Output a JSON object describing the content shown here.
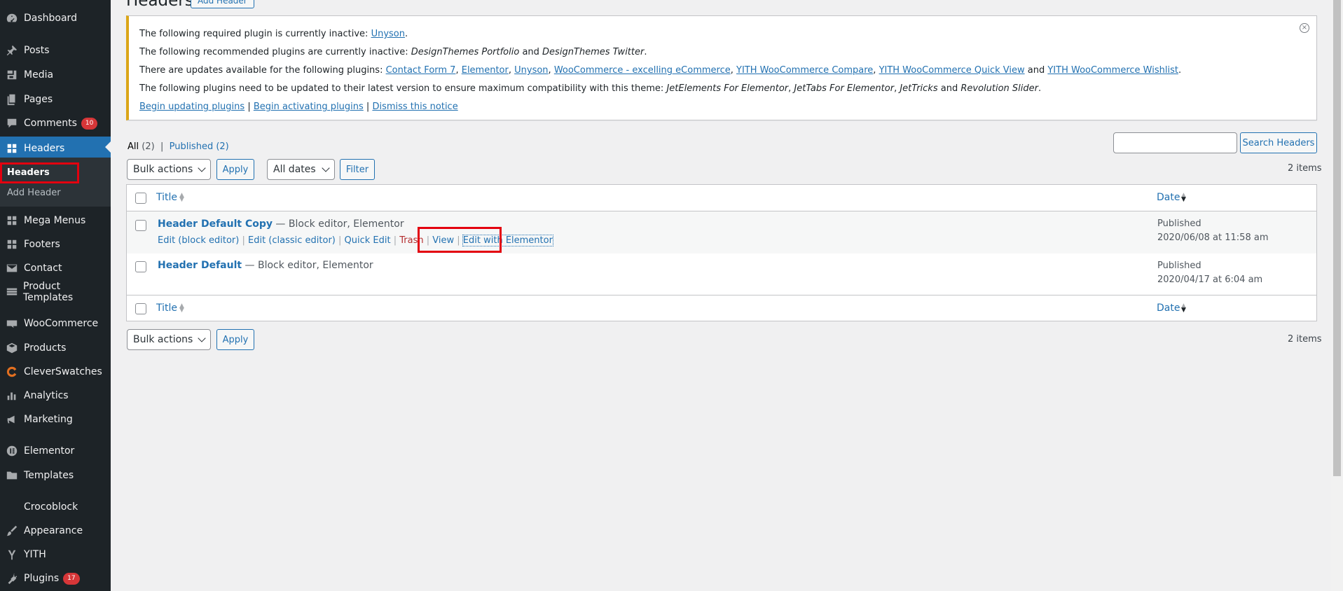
{
  "sidebar": {
    "items": [
      {
        "label": "Dashboard",
        "icon": "dashboard-icon"
      },
      {
        "label": "Posts",
        "icon": "pushpin-icon"
      },
      {
        "label": "Media",
        "icon": "media-icon"
      },
      {
        "label": "Pages",
        "icon": "pages-icon"
      },
      {
        "label": "Comments",
        "icon": "comments-icon",
        "badge": "10"
      },
      {
        "label": "Headers",
        "icon": "grid-icon"
      },
      {
        "label": "Mega Menus",
        "icon": "grid-icon"
      },
      {
        "label": "Footers",
        "icon": "grid-icon"
      },
      {
        "label": "Contact",
        "icon": "mail-icon"
      },
      {
        "label": "Product Templates",
        "icon": "table-icon"
      },
      {
        "label": "WooCommerce",
        "icon": "woo-icon"
      },
      {
        "label": "Products",
        "icon": "box-icon"
      },
      {
        "label": "CleverSwatches",
        "icon": "swatch-icon"
      },
      {
        "label": "Analytics",
        "icon": "bar-chart-icon"
      },
      {
        "label": "Marketing",
        "icon": "megaphone-icon"
      },
      {
        "label": "Elementor",
        "icon": "elementor-icon"
      },
      {
        "label": "Templates",
        "icon": "folder-icon"
      },
      {
        "label": "Crocoblock",
        "icon": ""
      },
      {
        "label": "Appearance",
        "icon": "brush-icon"
      },
      {
        "label": "YITH",
        "icon": "yith-icon"
      },
      {
        "label": "Plugins",
        "icon": "plug-icon",
        "badge": "17"
      }
    ],
    "submenu": {
      "headers": "Headers",
      "add_header": "Add Header"
    }
  },
  "page": {
    "title": "Headers",
    "add_button": "Add Header"
  },
  "notice": {
    "line1_pre": "The following required plugin is currently inactive: ",
    "line1_link": "Unyson",
    "line1_post": ".",
    "line2_pre": "The following recommended plugins are currently inactive: ",
    "line2_i1": "DesignThemes Portfolio",
    "line2_mid": " and ",
    "line2_i2": "DesignThemes Twitter",
    "line2_post": ".",
    "line3_pre": "There are updates available for the following plugins: ",
    "line3_links": [
      "Contact Form 7",
      "Elementor",
      "Unyson",
      "WooCommerce - excelling eCommerce",
      "YITH WooCommerce Compare",
      "YITH WooCommerce Quick View",
      "YITH WooCommerce Wishlist"
    ],
    "line3_and": " and ",
    "line4_pre": "The following plugins need to be updated to their latest version to ensure maximum compatibility with this theme: ",
    "line4_i1": "JetElements For Elementor",
    "line4_i2": "JetTabs For Elementor",
    "line4_i3": "JetTricks",
    "line4_i4": "Revolution Slider",
    "line4_and": " and ",
    "actions": [
      "Begin updating plugins",
      "Begin activating plugins",
      "Dismiss this notice"
    ]
  },
  "views": {
    "all": "All",
    "all_count": "(2)",
    "published": "Published",
    "published_count": "(2)"
  },
  "search": {
    "button": "Search Headers",
    "value": ""
  },
  "filters": {
    "bulk_actions": "Bulk actions",
    "apply": "Apply",
    "dates": "All dates",
    "filter": "Filter",
    "items_count": "2 items"
  },
  "table": {
    "columns": {
      "title": "Title",
      "date": "Date"
    },
    "rows": [
      {
        "title": "Header Default Copy",
        "state": " — Block editor, Elementor",
        "actions": [
          "Edit (block editor)",
          "Edit (classic editor)",
          "Quick Edit",
          "Trash",
          "View",
          "Edit with Elementor"
        ],
        "status": "Published",
        "date": "2020/06/08 at 11:58 am"
      },
      {
        "title": "Header Default",
        "state": " — Block editor, Elementor",
        "status": "Published",
        "date": "2020/04/17 at 6:04 am"
      }
    ]
  },
  "colors": {
    "sidebar": "#1d2327",
    "accent": "#2271b1",
    "highlight": "#e3000f",
    "notice_border": "#dba617"
  }
}
